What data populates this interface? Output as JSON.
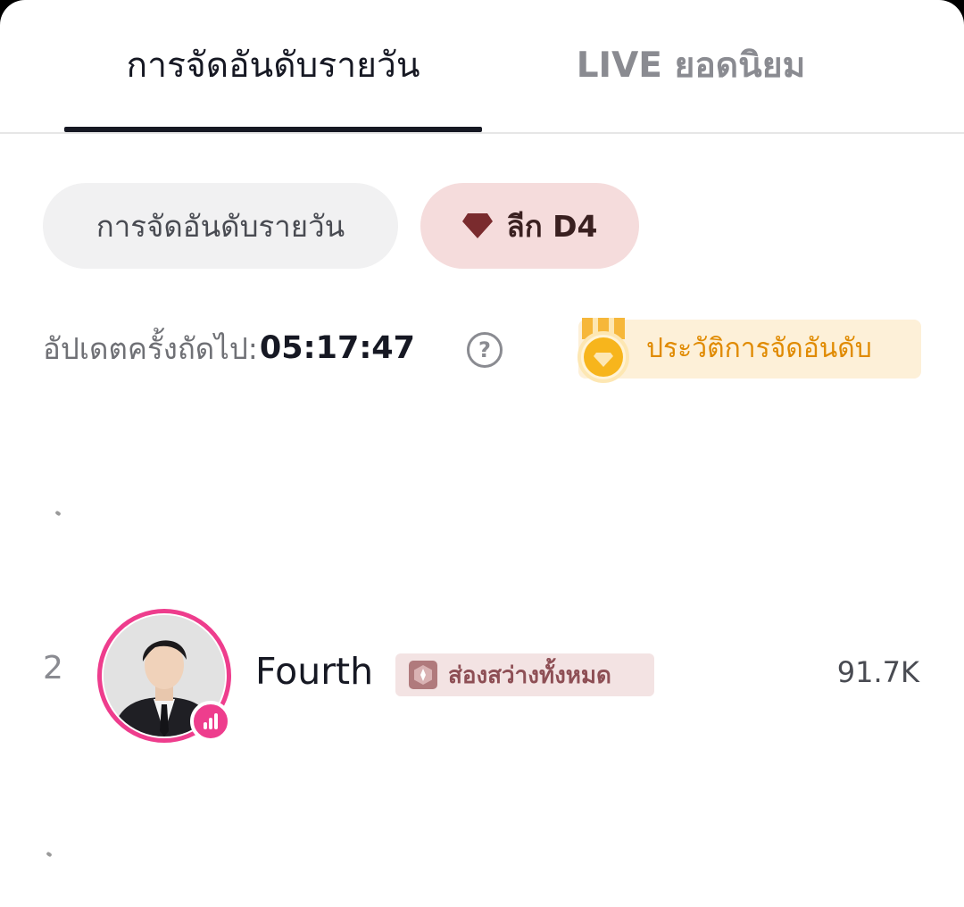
{
  "tabs": [
    {
      "label": "การจัดอันดับรายวัน",
      "active": true
    },
    {
      "label": "LIVE ยอดนิยม",
      "active": false
    }
  ],
  "chips": {
    "daily": "การจัดอันดับรายวัน",
    "league": "ลีก D4",
    "league_icon": "diamond-icon"
  },
  "countdown": {
    "label": "อัปเดตครั้งถัดไป:",
    "time": "05:17:47",
    "help_icon": "question-circle-icon"
  },
  "history": {
    "label": "ประวัติการจัดอันดับ",
    "icon": "gold-medal-icon"
  },
  "ranking": [
    {
      "rank": "2",
      "name": "Fourth",
      "badge": "ส่องสว่างทั้งหมด",
      "score": "91.7K"
    }
  ],
  "colors": {
    "accent_pink": "#ee3d8d",
    "league_chip_bg": "#f5dcdc",
    "history_text": "#e08a00",
    "history_bg": "#fdf0d8",
    "tab_active": "#161823",
    "tab_inactive": "#8a8b91"
  }
}
